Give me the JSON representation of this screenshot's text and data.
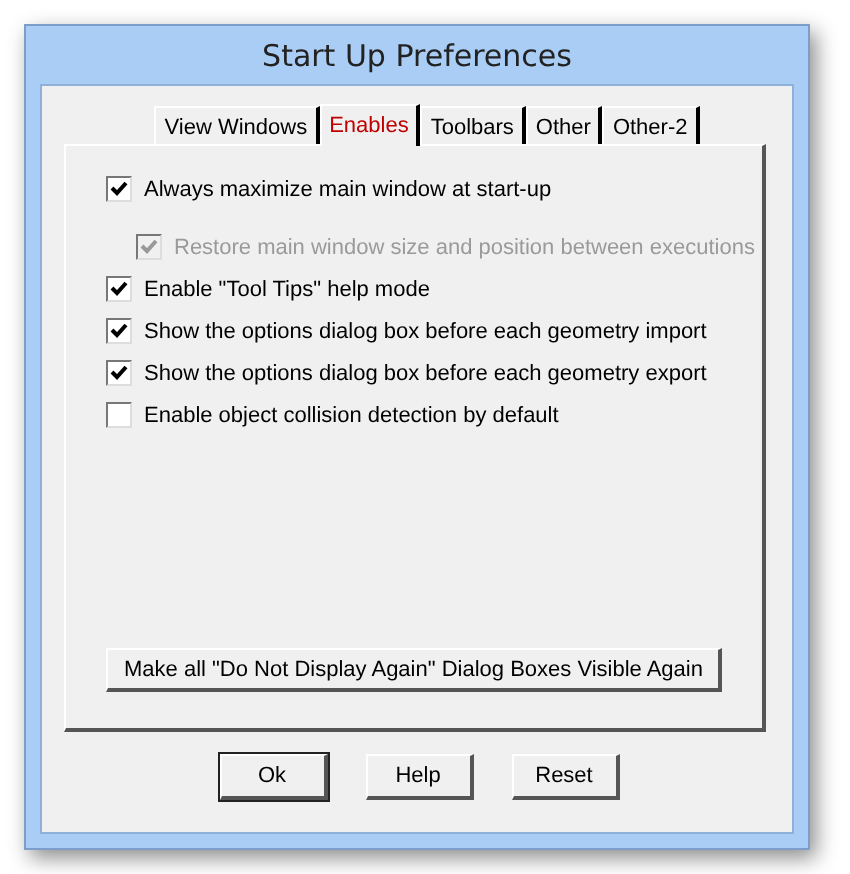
{
  "window": {
    "title": "Start Up Preferences"
  },
  "tabs": [
    {
      "label": "View Windows",
      "selected": false
    },
    {
      "label": "Enables",
      "selected": true
    },
    {
      "label": "Toolbars",
      "selected": false
    },
    {
      "label": "Other",
      "selected": false
    },
    {
      "label": "Other-2",
      "selected": false
    }
  ],
  "options": [
    {
      "label": "Always maximize main window at start-up",
      "checked": true,
      "disabled": false,
      "children": [
        {
          "label": "Restore main window size and position between executions",
          "checked": true,
          "disabled": true
        }
      ]
    },
    {
      "label": "Enable \"Tool Tips\" help mode",
      "checked": true,
      "disabled": false
    },
    {
      "label": "Show the options dialog box before each geometry import",
      "checked": true,
      "disabled": false
    },
    {
      "label": "Show the options dialog box before each geometry export",
      "checked": true,
      "disabled": false
    },
    {
      "label": "Enable object collision detection by default",
      "checked": false,
      "disabled": false
    }
  ],
  "panel_button": "Make all \"Do Not Display Again\" Dialog Boxes Visible Again",
  "buttons": [
    {
      "label": "Ok",
      "default": true
    },
    {
      "label": "Help",
      "default": false
    },
    {
      "label": "Reset",
      "default": false
    }
  ]
}
